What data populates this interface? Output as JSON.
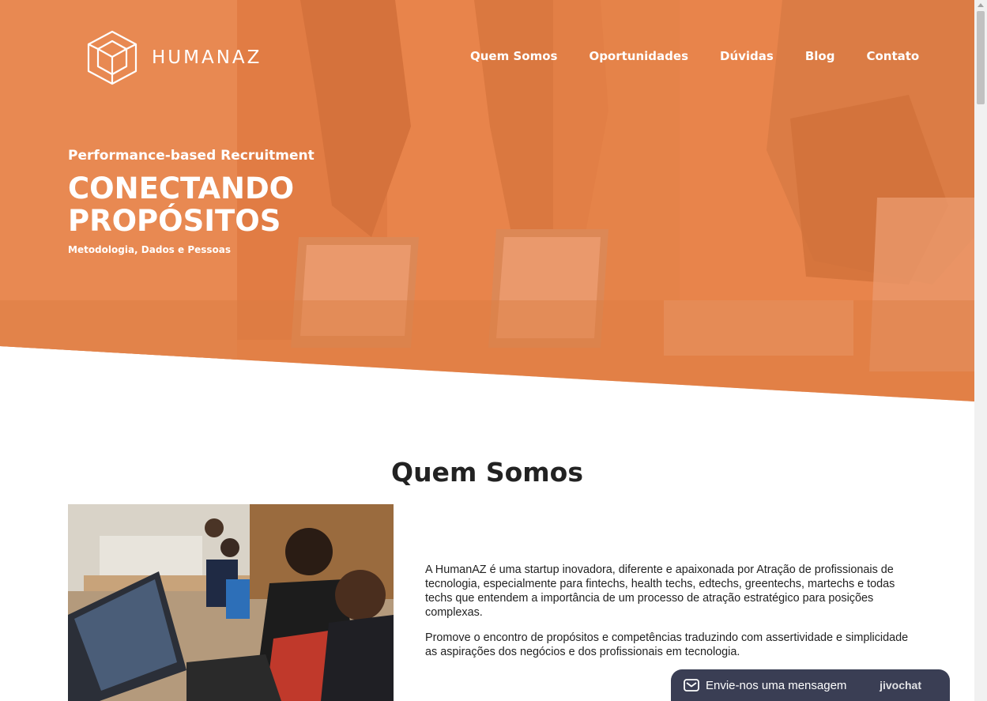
{
  "brand": {
    "name": "HUMANAZ"
  },
  "nav": {
    "items": [
      {
        "label": "Quem Somos"
      },
      {
        "label": "Oportunidades"
      },
      {
        "label": "Dúvidas"
      },
      {
        "label": "Blog"
      },
      {
        "label": "Contato"
      }
    ]
  },
  "hero": {
    "subtitle": "Performance-based Recruitment",
    "title_line1": "CONECTANDO",
    "title_line2": "PROPÓSITOS",
    "tagline": "Metodologia, Dados e Pessoas"
  },
  "about": {
    "title": "Quem Somos",
    "paragraph1": "A HumanAZ é uma startup inovadora, diferente e apaixonada por Atração de profissionais de tecnologia, especialmente para fintechs, health techs, edtechs, greentechs, martechs e todas techs que entendem a importância de um processo de atração estratégico para posições complexas.",
    "paragraph2": "Promove o encontro de propósitos e competências traduzindo com assertividade e simplicidade as aspirações dos negócios e dos profissionais em tecnologia."
  },
  "chat": {
    "label": "Envie-nos uma mensagem",
    "brand": "jivochat",
    "icon": "envelope-icon"
  },
  "colors": {
    "hero_overlay": "#e8844b",
    "chat_bg": "#3a3e54",
    "heading": "#222222"
  }
}
